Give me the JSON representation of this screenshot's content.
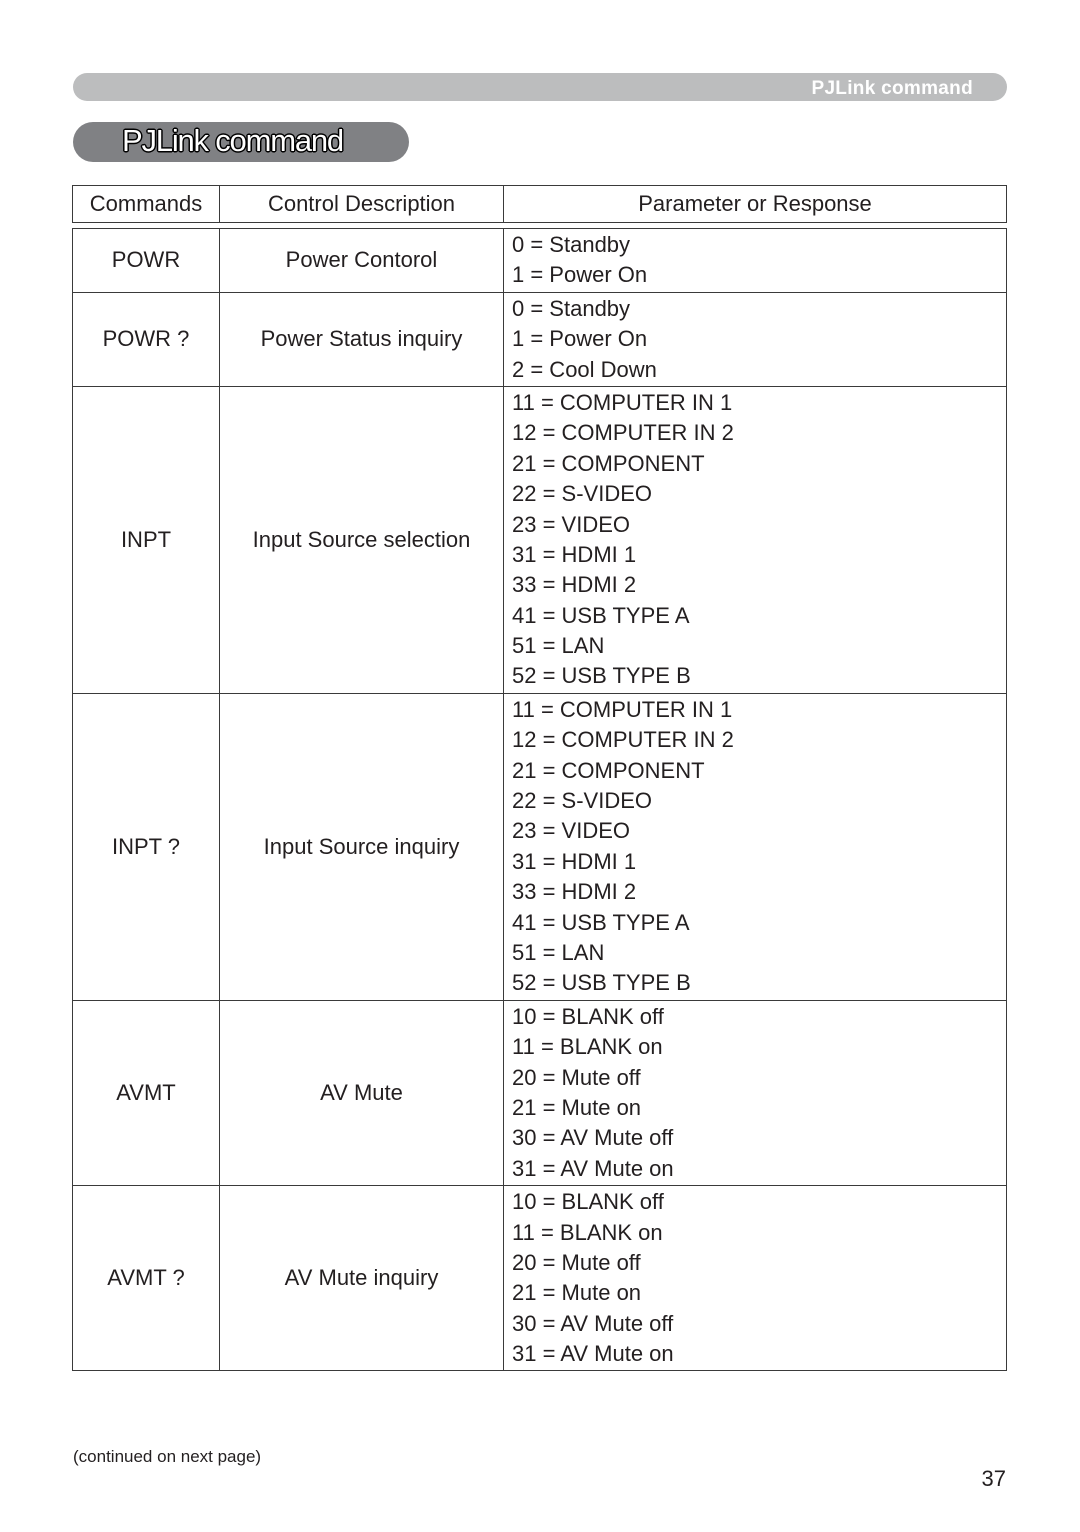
{
  "header": {
    "section_label": "PJLink command",
    "title": "PJLink command"
  },
  "table": {
    "columns": [
      "Commands",
      "Control Description",
      "Parameter or Response"
    ],
    "rows": [
      {
        "command": "POWR",
        "description": "Power Contorol",
        "responses": [
          "0 = Standby",
          "1 = Power On"
        ]
      },
      {
        "command": "POWR ?",
        "description": "Power Status inquiry",
        "responses": [
          "0 = Standby",
          "1 = Power On",
          "2 = Cool Down"
        ]
      },
      {
        "command": "INPT",
        "description": "Input Source selection",
        "responses": [
          "11 = COMPUTER IN 1",
          "12 = COMPUTER IN 2",
          "21 = COMPONENT",
          "22 = S-VIDEO",
          "23 = VIDEO",
          "31 = HDMI 1",
          "33 = HDMI 2",
          "41 = USB TYPE A",
          "51 = LAN",
          "52 = USB TYPE B"
        ]
      },
      {
        "command": "INPT ?",
        "description": "Input Source inquiry",
        "responses": [
          "11 = COMPUTER IN 1",
          "12 = COMPUTER IN 2",
          "21 = COMPONENT",
          "22 = S-VIDEO",
          "23 = VIDEO",
          "31 = HDMI 1",
          "33 = HDMI 2",
          "41 = USB TYPE A",
          "51 = LAN",
          "52 = USB TYPE B"
        ]
      },
      {
        "command": "AVMT",
        "description": "AV Mute",
        "responses": [
          "10 = BLANK off",
          "11 = BLANK on",
          "20 = Mute off",
          "21 = Mute on",
          "30 = AV Mute off",
          "31 = AV Mute on"
        ]
      },
      {
        "command": "AVMT ?",
        "description": "AV Mute inquiry",
        "responses": [
          "10 = BLANK off",
          "11 = BLANK on",
          "20 = Mute off",
          "21 = Mute on",
          "30 = AV Mute off",
          "31 = AV Mute on"
        ]
      }
    ]
  },
  "footer": {
    "note": "(continued on next page)",
    "page_number": "37"
  }
}
